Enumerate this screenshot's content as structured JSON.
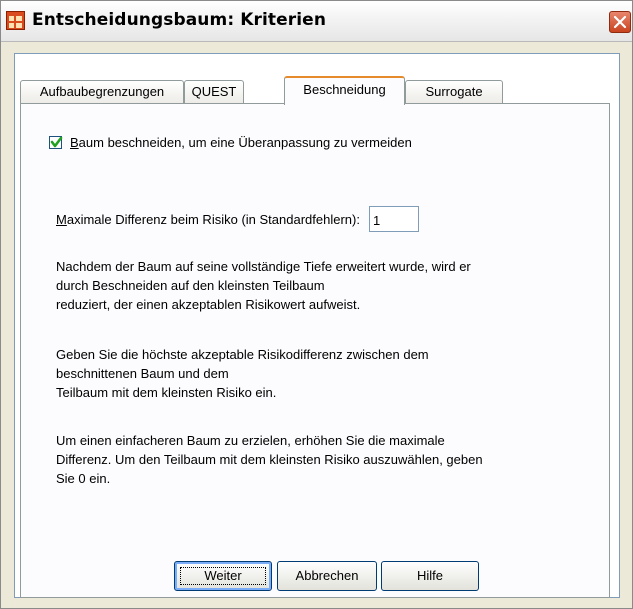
{
  "window": {
    "title": "Entscheidungsbaum: Kriterien"
  },
  "tabs": [
    {
      "label": "Aufbaubegrenzungen"
    },
    {
      "label": "QUEST"
    },
    {
      "label": "Beschneidung"
    },
    {
      "label": "Surrogate"
    }
  ],
  "active_tab": "Beschneidung",
  "prune": {
    "checked": true,
    "label_mnemonic": "B",
    "label_rest": "aum beschneiden, um eine Überanpassung zu vermeiden"
  },
  "max_diff": {
    "label_mnemonic": "M",
    "label_rest": "aximale Differenz beim Risiko (in Standardfehlern):",
    "value": "1"
  },
  "paragraphs": [
    "Nachdem der Baum auf seine vollständige Tiefe erweitert wurde, wird er\ndurch Beschneiden auf den kleinsten Teilbaum\nreduziert, der einen akzeptablen Risikowert aufweist.",
    "Geben Sie die höchste akzeptable Risikodifferenz zwischen dem\nbeschnittenen Baum und dem\nTeilbaum mit dem kleinsten Risiko ein.",
    "Um einen einfacheren Baum zu erzielen, erhöhen Sie die maximale\nDifferenz. Um den Teilbaum mit dem kleinsten Risiko auszuwählen, geben\nSie 0 ein."
  ],
  "buttons": {
    "continue": "Weiter",
    "cancel": "Abbrechen",
    "help": "Hilfe"
  },
  "icons": {
    "app": "spss-grid-icon",
    "close": "close-icon",
    "check": "checkmark-icon"
  },
  "colors": {
    "tab_active_accent": "#e68b2c",
    "close_button": "#c9431f",
    "app_icon": "#d94a1e",
    "checkmark": "#21a121"
  }
}
